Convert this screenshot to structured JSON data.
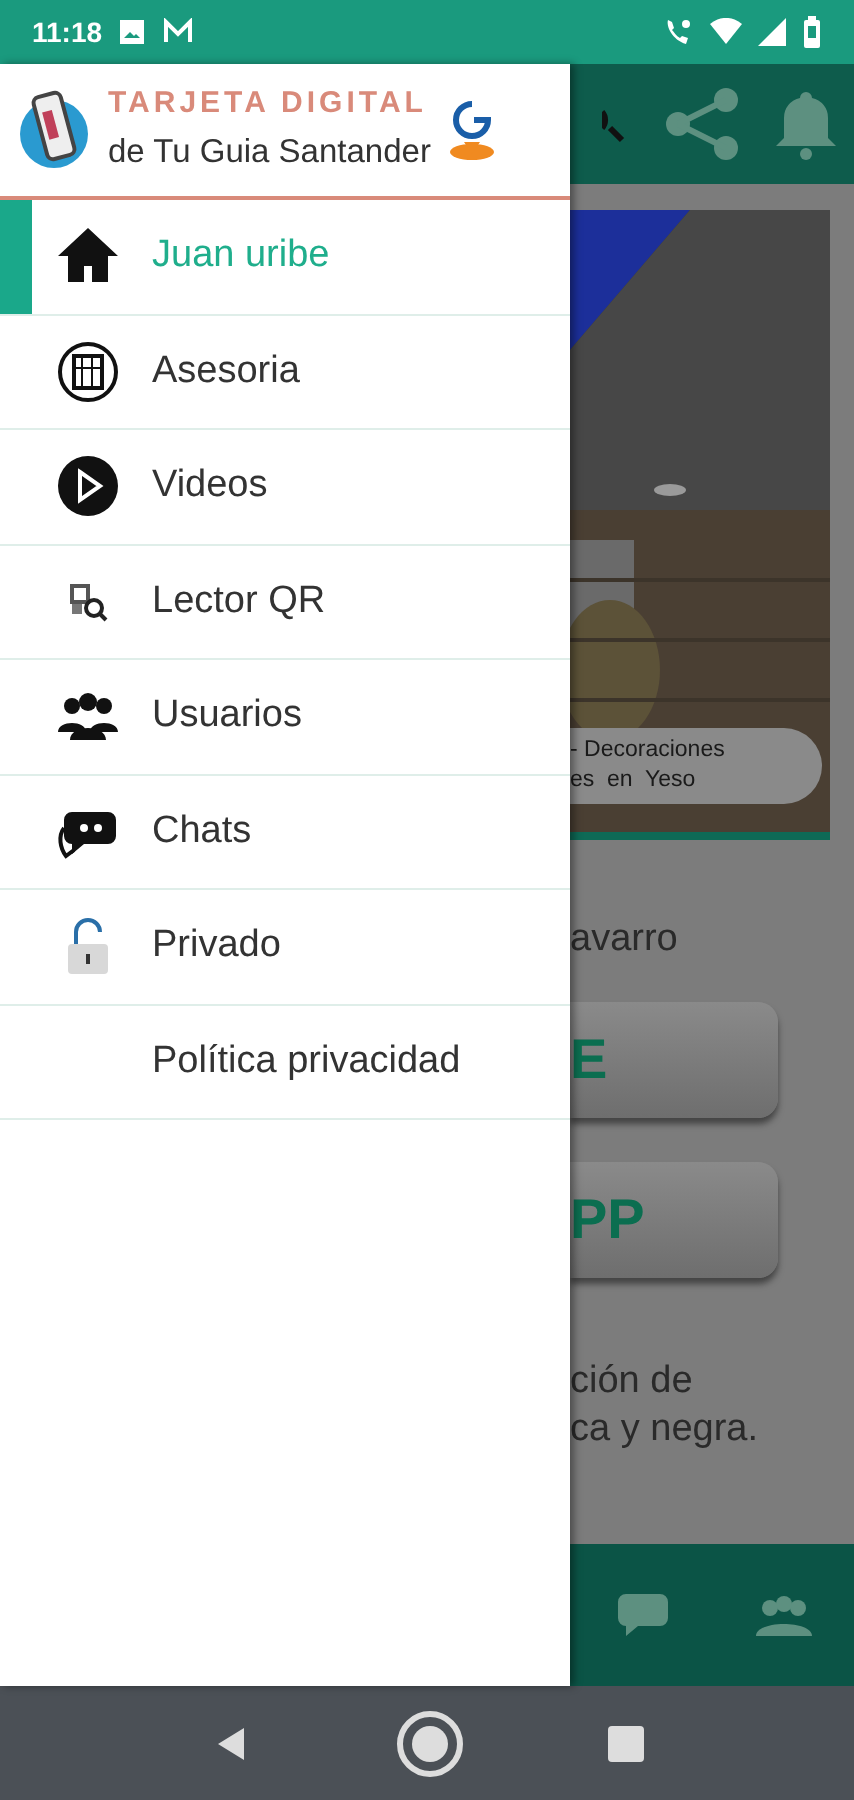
{
  "status_bar": {
    "time": "11:18"
  },
  "drawer": {
    "header": {
      "title": "TARJETA DIGITAL",
      "subtitle": "de Tu Guia Santander"
    },
    "items": [
      {
        "label": "Juan uribe",
        "selected": true
      },
      {
        "label": "Asesoria",
        "selected": false
      },
      {
        "label": "Videos",
        "selected": false
      },
      {
        "label": "Lector QR",
        "selected": false
      },
      {
        "label": "Usuarios",
        "selected": false
      },
      {
        "label": "Chats",
        "selected": false
      },
      {
        "label": "Privado",
        "selected": false
      },
      {
        "label": "Política privacidad",
        "selected": false
      }
    ]
  },
  "background_app": {
    "image_caption": [
      "- Decoraciones",
      "es  en  Yeso"
    ],
    "name_text": "avarro",
    "buttons": [
      "E",
      "PP"
    ],
    "description": [
      "ción de",
      "ca y negra."
    ]
  }
}
